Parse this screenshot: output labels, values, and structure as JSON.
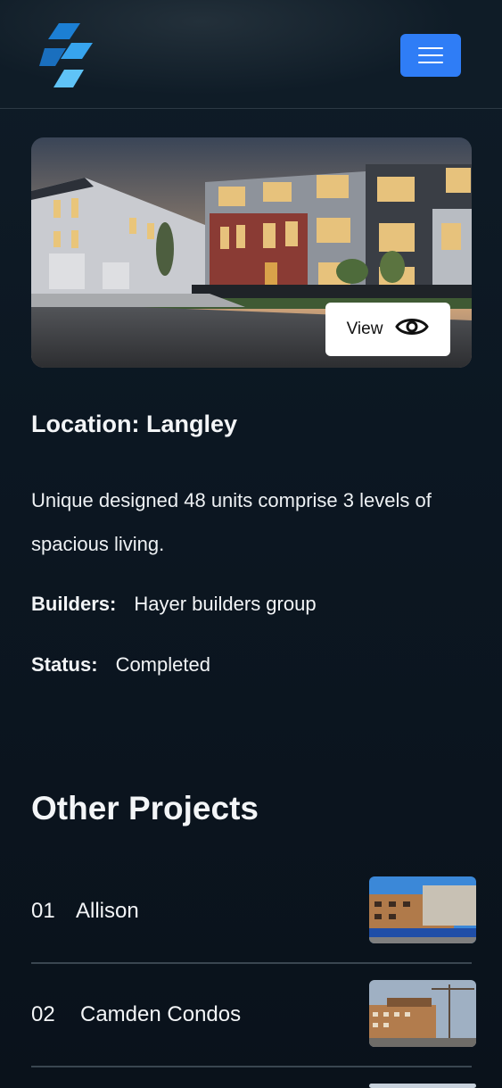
{
  "header": {
    "logo_icon": "brand-logo-icon",
    "menu_icon": "hamburger-menu-icon",
    "accent": "#2f7df6"
  },
  "hero": {
    "view_label": "View",
    "view_icon": "eye-icon"
  },
  "project": {
    "location": "Location: Langley",
    "description": "Unique designed 48 units comprise 3 levels of spacious living.",
    "builders_label": "Builders:",
    "builders_value": "Hayer builders group",
    "status_label": "Status:",
    "status_value": "Completed"
  },
  "other": {
    "title": "Other Projects",
    "items": [
      {
        "num": "01",
        "name": "Allison"
      },
      {
        "num": "02",
        "name": "Camden Condos"
      }
    ]
  }
}
